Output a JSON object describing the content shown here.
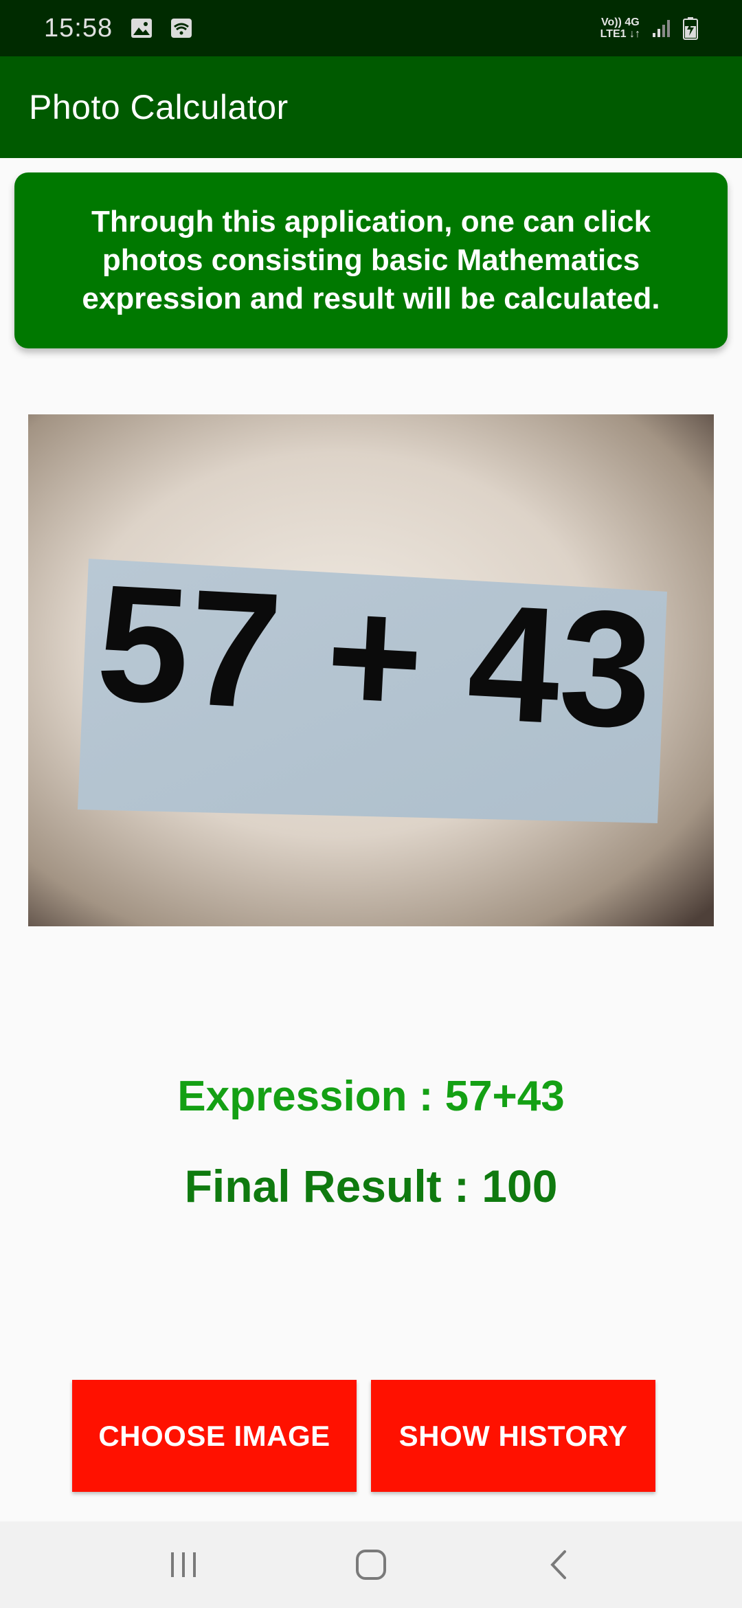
{
  "status_bar": {
    "time": "15:58",
    "network_line1": "Vo)) 4G",
    "network_line2": "LTE1 ↓↑",
    "icons": [
      "gallery-icon",
      "wifi-icon",
      "signal-icon",
      "battery-icon"
    ]
  },
  "app_bar": {
    "title": "Photo Calculator"
  },
  "info_card": {
    "text": "Through this application, one can click photos consisting basic Mathematics expression and result will be calculated."
  },
  "photo": {
    "content": "57 + 43"
  },
  "results": {
    "expression": "Expression : 57+43",
    "final_result": "Final Result : 100"
  },
  "buttons": {
    "choose_image": "CHOOSE IMAGE",
    "show_history": "SHOW HISTORY"
  },
  "nav_bar": {
    "icons": [
      "recents-icon",
      "home-icon",
      "back-icon"
    ]
  },
  "colors": {
    "status_bar": "#002b00",
    "app_bar": "#005a00",
    "info_card": "#007800",
    "expression_text": "#14a014",
    "result_text": "#0f7a0f",
    "button": "#ff1100"
  }
}
